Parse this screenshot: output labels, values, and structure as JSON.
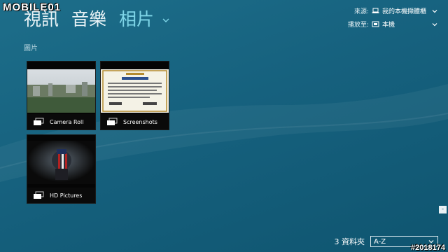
{
  "watermark": "MOBILE01",
  "nav": {
    "items": [
      {
        "label": "視訊"
      },
      {
        "label": "音樂"
      },
      {
        "label": "相片"
      }
    ]
  },
  "source_panel": {
    "source_label": "來源:",
    "source_value": "我的本機擷體櫃",
    "playto_label": "播放至:",
    "playto_value": "本機"
  },
  "section_title": "圖片",
  "tiles": [
    {
      "label": "Camera Roll"
    },
    {
      "label": "Screenshots"
    },
    {
      "label": "HD Pictures"
    }
  ],
  "collapse_glyph": "-",
  "footer": {
    "count": "3 資料夾",
    "sort_value": "A-Z"
  },
  "id_label": "#2018174",
  "colors": {
    "accent": "#7fd6e8",
    "background": "#16617e"
  }
}
